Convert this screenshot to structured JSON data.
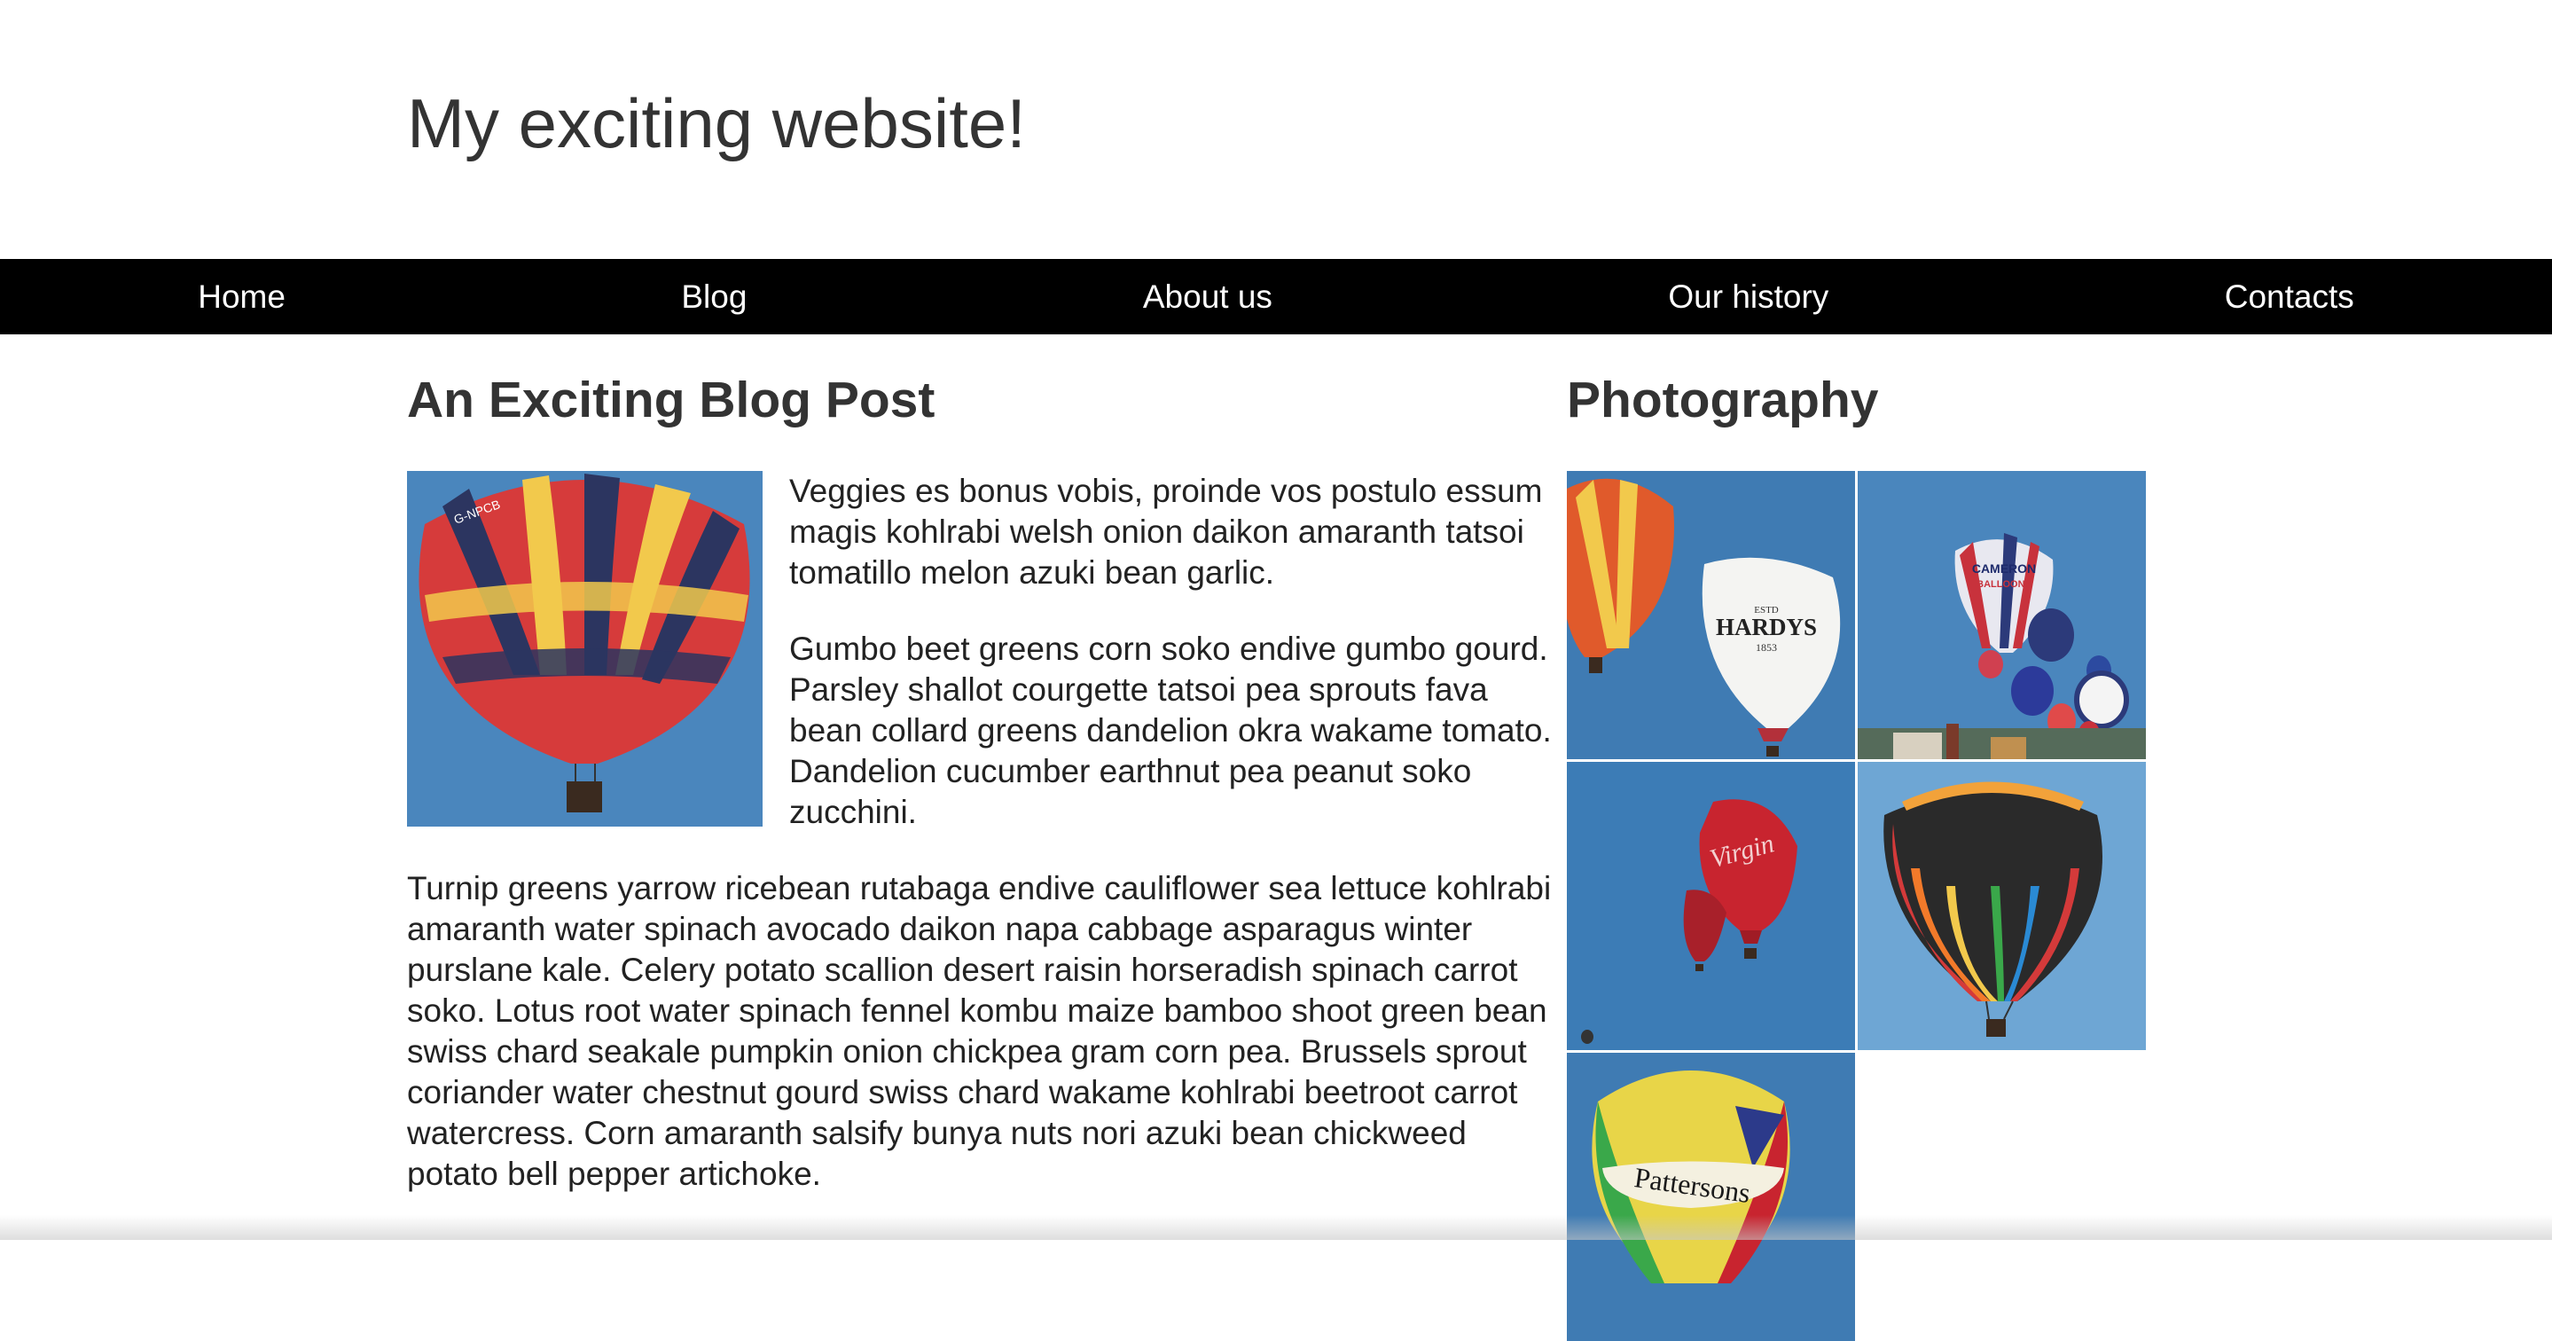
{
  "site": {
    "title": "My exciting website!"
  },
  "nav": {
    "items": [
      {
        "label": "Home"
      },
      {
        "label": "Blog"
      },
      {
        "label": "About us"
      },
      {
        "label": "Our history"
      },
      {
        "label": "Contacts"
      }
    ]
  },
  "main": {
    "heading": "An Exciting Blog Post",
    "paragraphs": [
      "Veggies es bonus vobis, proinde vos postulo essum magis kohlrabi welsh onion daikon amaranth tatsoi tomatillo melon azuki bean garlic.",
      "Gumbo beet greens corn soko endive gumbo gourd. Parsley shallot courgette tatsoi pea sprouts fava bean collard greens dandelion okra wakame tomato. Dandelion cucumber earthnut pea peanut soko zucchini.",
      "Turnip greens yarrow ricebean rutabaga endive cauliflower sea lettuce kohlrabi amaranth water spinach avocado daikon napa cabbage asparagus winter purslane kale. Celery potato scallion desert raisin horseradish spinach carrot soko. Lotus root water spinach fennel kombu maize bamboo shoot green bean swiss chard seakale pumpkin onion chickpea gram corn pea. Brussels sprout coriander water chestnut gourd swiss chard wakame kohlrabi beetroot carrot watercress. Corn amaranth salsify bunya nuts nori azuki bean chickweed potato bell pepper artichoke."
    ],
    "image_text": "G-NPCB"
  },
  "sidebar": {
    "heading": "Photography",
    "photos": [
      {
        "balloon_text_1": "ESTD",
        "balloon_text_2": "HARDYS",
        "balloon_text_3": "1853"
      },
      {
        "balloon_text_1": "CAMERON",
        "balloon_text_2": "BALLOONS"
      },
      {
        "balloon_text_1": "Virgin"
      },
      {},
      {
        "balloon_text_1": "Pattersons"
      }
    ]
  },
  "colors": {
    "nav_background": "#000000",
    "nav_text": "#ffffff",
    "sky": "#4a86bd",
    "text": "#333333"
  }
}
